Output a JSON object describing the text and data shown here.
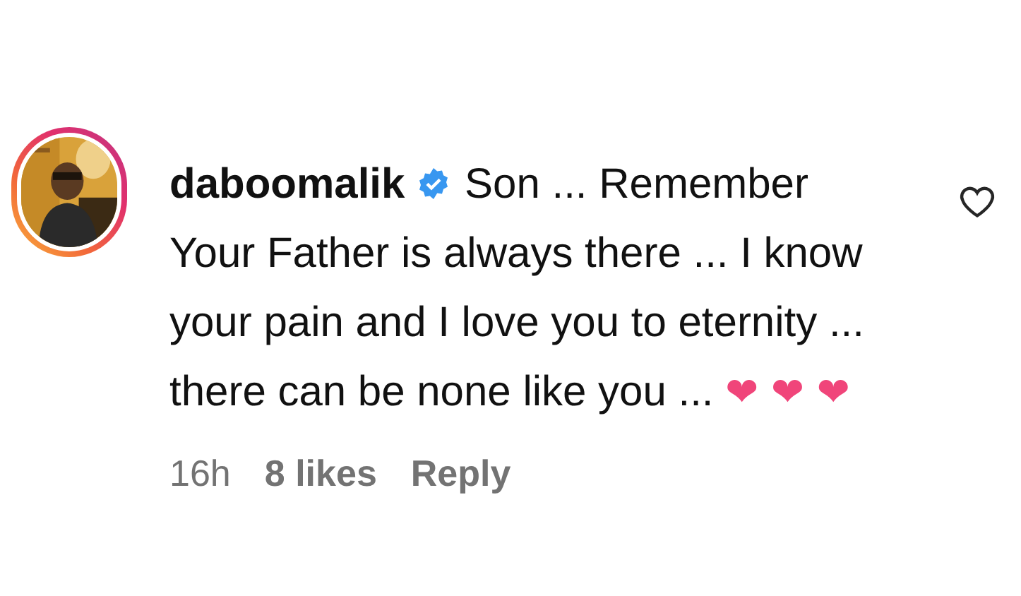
{
  "comment": {
    "username": "daboomalik",
    "verified": true,
    "text": "Son ... Remember Your Father is always there ... I know your pain and I love you to eternity ... there can be none like you ...",
    "emoji": "❤ ❤ ❤",
    "liked": false,
    "time": "16h",
    "likes": "8 likes",
    "reply": "Reply"
  }
}
